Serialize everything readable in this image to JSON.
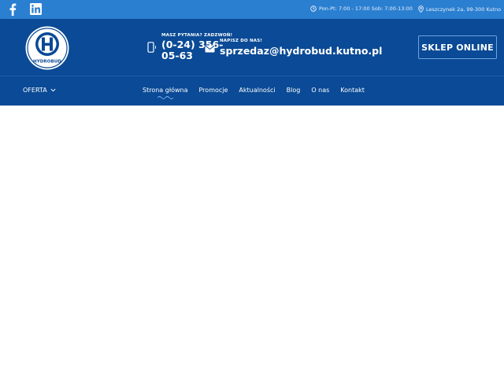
{
  "topbar": {
    "social": [
      {
        "icon": "facebook-icon"
      },
      {
        "icon": "linkedin-icon"
      }
    ],
    "hours": "Pon-Pt: 7:00 - 17:00 Sob: 7:00-13:00",
    "address": "Leszczynek 2a, 99-300 Kutno"
  },
  "header": {
    "logo_text": "HYDROBUD",
    "phone_label": "MASZ PYTANIA? ZADZWOŃ!",
    "phone": "(0-24) 356-05-63",
    "mail_label": "NAPISZ DO NAS!",
    "email": "sprzedaz@hydrobud.kutno.pl",
    "shop_button": "SKLEP ONLINE"
  },
  "nav": {
    "offer": "OFERTA",
    "items": [
      {
        "label": "Strona główna"
      },
      {
        "label": "Promocje"
      },
      {
        "label": "Aktualności"
      },
      {
        "label": "Blog"
      },
      {
        "label": "O nas"
      },
      {
        "label": "Kontakt"
      }
    ]
  },
  "colors": {
    "topbar": "#2b7fd0",
    "header": "#0a4a96"
  }
}
